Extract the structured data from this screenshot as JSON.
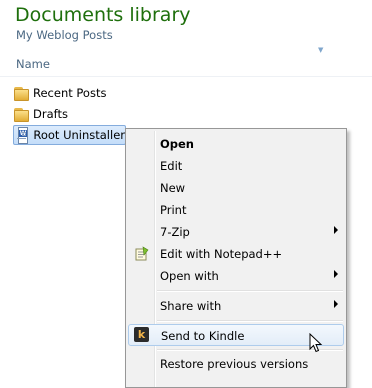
{
  "library": {
    "title": "Documents library",
    "subtitle": "My Weblog Posts",
    "column_name": "Name"
  },
  "files": [
    {
      "label": "Recent Posts",
      "icon": "folder-icon"
    },
    {
      "label": "Drafts",
      "icon": "folder-icon"
    },
    {
      "label": "Root Uninstaller",
      "icon": "word-document-icon",
      "selected": true
    }
  ],
  "context_menu": {
    "items": [
      {
        "label": "Open",
        "bold": true
      },
      {
        "label": "Edit"
      },
      {
        "label": "New"
      },
      {
        "label": "Print"
      },
      {
        "label": "7-Zip",
        "submenu": true
      },
      {
        "label": "Edit with Notepad++",
        "icon": "notepad-plus-plus-icon"
      },
      {
        "label": "Open with",
        "submenu": true
      },
      {
        "label": "Share with",
        "submenu": true
      },
      {
        "label": "Send to Kindle",
        "icon": "kindle-icon",
        "hovered": true
      },
      {
        "label": "Restore previous versions"
      }
    ]
  },
  "colors": {
    "title": "#1e6f0c",
    "subtitle": "#4a6782",
    "selection": "#c4ddf9",
    "menu_bg": "#f1f1f1"
  }
}
